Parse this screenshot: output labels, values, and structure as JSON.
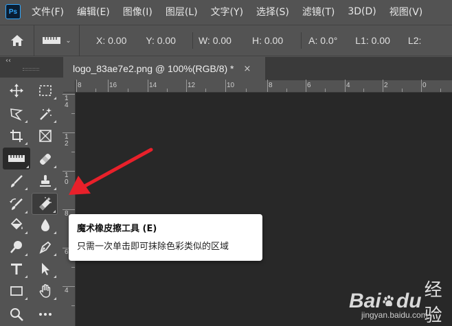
{
  "menubar": {
    "logo": "Ps",
    "items": [
      "文件(F)",
      "编辑(E)",
      "图像(I)",
      "图层(L)",
      "文字(Y)",
      "选择(S)",
      "滤镜(T)",
      "3D(D)",
      "视图(V)"
    ]
  },
  "options": {
    "x": "X: 0.00",
    "y": "Y: 0.00",
    "w": "W: 0.00",
    "h": "H: 0.00",
    "a": "A: 0.0°",
    "l1": "L1: 0.00",
    "l2": "L2:"
  },
  "toolbar": {
    "collapse": "‹‹"
  },
  "document": {
    "tab_title": "logo_83ae7e2.png @ 100%(RGB/8) *",
    "tab_close": "×",
    "hruler_labels": [
      "8",
      "16",
      "14",
      "12",
      "10",
      "8",
      "6",
      "4",
      "2",
      "0"
    ],
    "vruler_labels": [
      "14",
      "12",
      "10",
      "8",
      "6",
      "4"
    ]
  },
  "tooltip": {
    "title": "魔术橡皮擦工具 (E)",
    "description": "只需一次单击即可抹除色彩类似的区域"
  },
  "watermark": {
    "bai": "Bai",
    "du": "du",
    "jingyan": "经验",
    "url": "jingyan.baidu.com"
  },
  "colors": {
    "accent_ps": "#31a8ff",
    "arrow": "#e8202a",
    "canvas": "#282828",
    "panel": "#535353"
  }
}
